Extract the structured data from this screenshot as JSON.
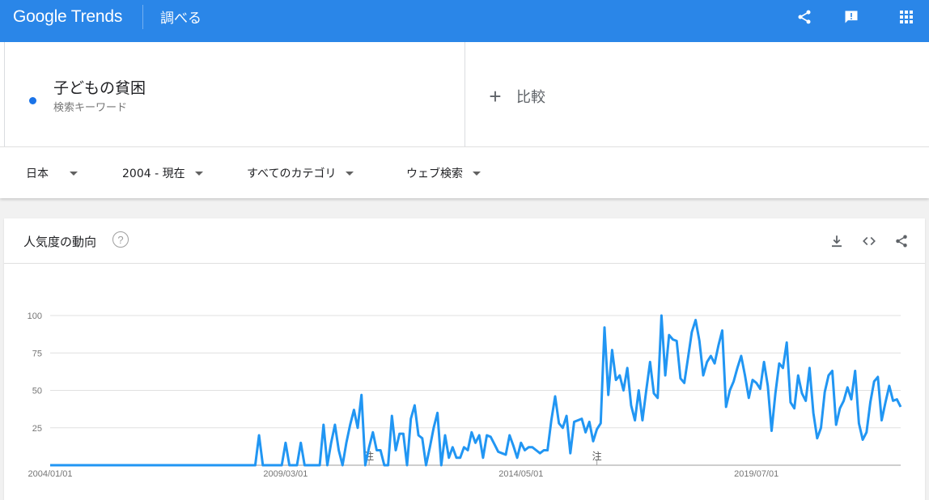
{
  "header": {
    "logo": "Google Trends",
    "section": "調べる",
    "icons": [
      "share-icon",
      "feedback-icon",
      "apps-icon"
    ]
  },
  "term": {
    "name": "子どもの貧困",
    "type": "検索キーワード",
    "color": "#1a73e8"
  },
  "compare": {
    "plus": "+",
    "label": "比較"
  },
  "filters": {
    "region": "日本",
    "time": "2004 - 現在",
    "category": "すべてのカテゴリ",
    "search_type": "ウェブ検索"
  },
  "card": {
    "title": "人気度の動向",
    "help": "?",
    "icons": [
      "download-icon",
      "embed-icon",
      "share-icon"
    ]
  },
  "chart_data": {
    "type": "line",
    "line_color": "#2196f3",
    "grid": true,
    "ylim": [
      0,
      100
    ],
    "y_ticks": [
      "100",
      "75",
      "50",
      "25"
    ],
    "x_ticks": [
      "2004/01/01",
      "2009/03/01",
      "2014/05/01",
      "2019/07/01"
    ],
    "notes": [
      "注",
      "注"
    ],
    "x_start": "2004/01/01",
    "x_end": "2020/12/01",
    "x_step": "1 month",
    "values": [
      0,
      0,
      0,
      0,
      0,
      0,
      0,
      0,
      0,
      0,
      0,
      0,
      0,
      0,
      0,
      0,
      0,
      0,
      0,
      0,
      0,
      0,
      0,
      0,
      0,
      0,
      0,
      0,
      0,
      0,
      0,
      0,
      0,
      0,
      0,
      0,
      0,
      0,
      0,
      0,
      0,
      0,
      0,
      0,
      0,
      0,
      0,
      0,
      0,
      0,
      0,
      0,
      0,
      0,
      0,
      20,
      0,
      0,
      0,
      0,
      0,
      0,
      15,
      0,
      0,
      0,
      15,
      0,
      0,
      0,
      0,
      0,
      27,
      0,
      15,
      27,
      10,
      0,
      15,
      27,
      37,
      25,
      47,
      0,
      12,
      22,
      10,
      10,
      0,
      0,
      33,
      10,
      21,
      21,
      0,
      31,
      40,
      20,
      18,
      0,
      12,
      25,
      35,
      0,
      20,
      5,
      12,
      5,
      5,
      12,
      10,
      22,
      15,
      20,
      5,
      20,
      19,
      14,
      9,
      8,
      7,
      20,
      13,
      5,
      15,
      10,
      12,
      12,
      10,
      8,
      10,
      10,
      30,
      46,
      28,
      25,
      33,
      8,
      29,
      30,
      31,
      22,
      29,
      16,
      24,
      28,
      92,
      47,
      77,
      57,
      60,
      50,
      65,
      40,
      30,
      50,
      30,
      50,
      69,
      48,
      45,
      100,
      60,
      87,
      84,
      83,
      58,
      55,
      72,
      89,
      97,
      83,
      60,
      69,
      73,
      68,
      80,
      90,
      39,
      50,
      56,
      65,
      73,
      60,
      45,
      57,
      55,
      51,
      69,
      53,
      23,
      48,
      68,
      65,
      82,
      42,
      38,
      60,
      48,
      43,
      65,
      35,
      18,
      25,
      49,
      60,
      63,
      27,
      38,
      43,
      52,
      44,
      63,
      28,
      17,
      22,
      42,
      56,
      59,
      30,
      42,
      53,
      43,
      44,
      39
    ]
  }
}
